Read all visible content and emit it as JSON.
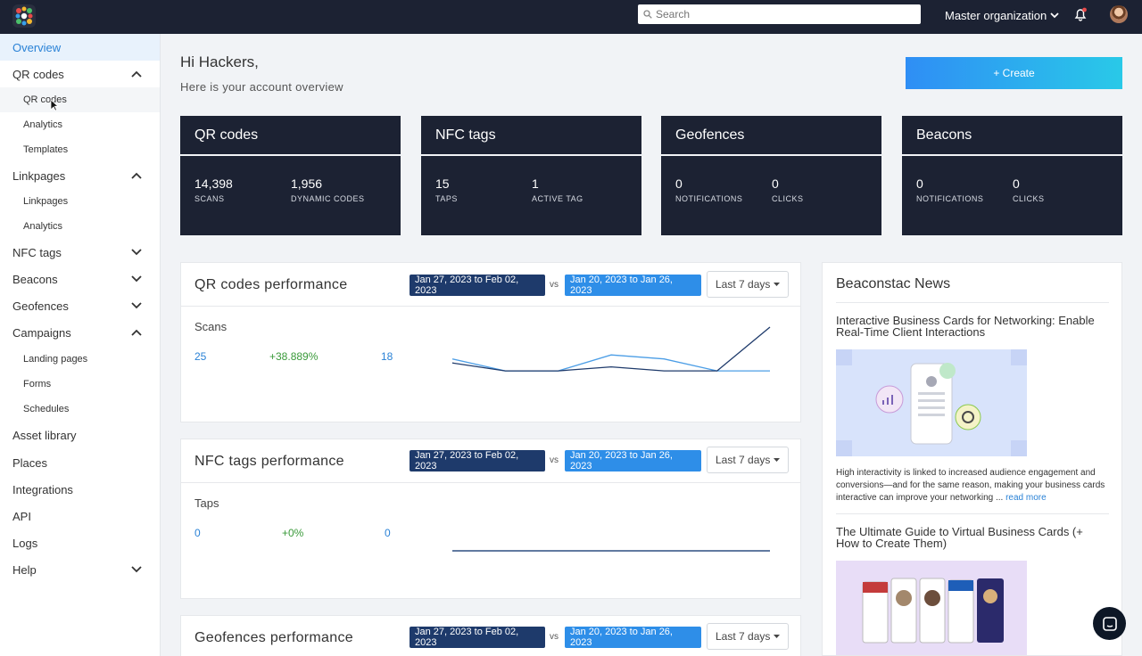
{
  "topbar": {
    "search_placeholder": "Search",
    "org_label": "Master organization"
  },
  "sidebar": {
    "overview": "Overview",
    "qr_codes": "QR codes",
    "qr_sub_qr_codes": "QR codes",
    "qr_sub_analytics": "Analytics",
    "qr_sub_templates": "Templates",
    "linkpages": "Linkpages",
    "lp_sub_linkpages": "Linkpages",
    "lp_sub_analytics": "Analytics",
    "nfc_tags": "NFC tags",
    "beacons": "Beacons",
    "geofences": "Geofences",
    "campaigns": "Campaigns",
    "camp_sub_landing": "Landing pages",
    "camp_sub_forms": "Forms",
    "camp_sub_schedules": "Schedules",
    "asset_library": "Asset library",
    "places": "Places",
    "integrations": "Integrations",
    "api": "API",
    "logs": "Logs",
    "help": "Help"
  },
  "header": {
    "greeting": "Hi Hackers,",
    "subtitle": "Here is your account overview",
    "create_button": "+ Create"
  },
  "stats": {
    "qr": {
      "title": "QR codes",
      "v1": "14,398",
      "l1": "SCANS",
      "v2": "1,956",
      "l2": "DYNAMIC CODES"
    },
    "nfc": {
      "title": "NFC tags",
      "v1": "15",
      "l1": "TAPS",
      "v2": "1",
      "l2": "ACTIVE TAG"
    },
    "geo": {
      "title": "Geofences",
      "v1": "0",
      "l1": "NOTIFICATIONS",
      "v2": "0",
      "l2": "CLICKS"
    },
    "bea": {
      "title": "Beacons",
      "v1": "0",
      "l1": "NOTIFICATIONS",
      "v2": "0",
      "l2": "CLICKS"
    }
  },
  "performance": {
    "range_a": "Jan 27, 2023 to Feb 02, 2023",
    "vs": "vs",
    "range_b": "Jan 20, 2023 to Jan 26, 2023",
    "dropdown": "Last 7 days",
    "qr": {
      "title": "QR codes performance",
      "metric": "Scans",
      "current": "25",
      "change": "+38.889%",
      "previous": "18",
      "current_series": [
        4,
        2,
        2,
        3,
        2,
        2,
        13
      ],
      "previous_series": [
        5,
        2,
        2,
        6,
        5,
        2,
        2
      ]
    },
    "nfc": {
      "title": "NFC tags performance",
      "metric": "Taps",
      "current": "0",
      "change": "+0%",
      "previous": "0",
      "current_series": [
        0,
        0,
        0,
        0,
        0,
        0,
        0
      ],
      "previous_series": [
        0,
        0,
        0,
        0,
        0,
        0,
        0
      ]
    },
    "geo": {
      "title": "Geofences performance"
    }
  },
  "news": {
    "heading": "Beaconstac News",
    "a1_title": "Interactive Business Cards for Networking: Enable Real-Time Client Interactions",
    "a1_text": "High interactivity is linked to increased audience engagement and conversions—and for the same reason, making your business cards interactive can improve your networking ...",
    "read_more": "read more",
    "a2_title": "The Ultimate Guide to Virtual Business Cards (+ How to Create Them)"
  },
  "colors": {
    "topbar": "#1c2233",
    "accent": "#2a82d6",
    "positive": "#3a9a3a",
    "range_a": "#1e3a6b",
    "range_b": "#2e8ee8"
  }
}
